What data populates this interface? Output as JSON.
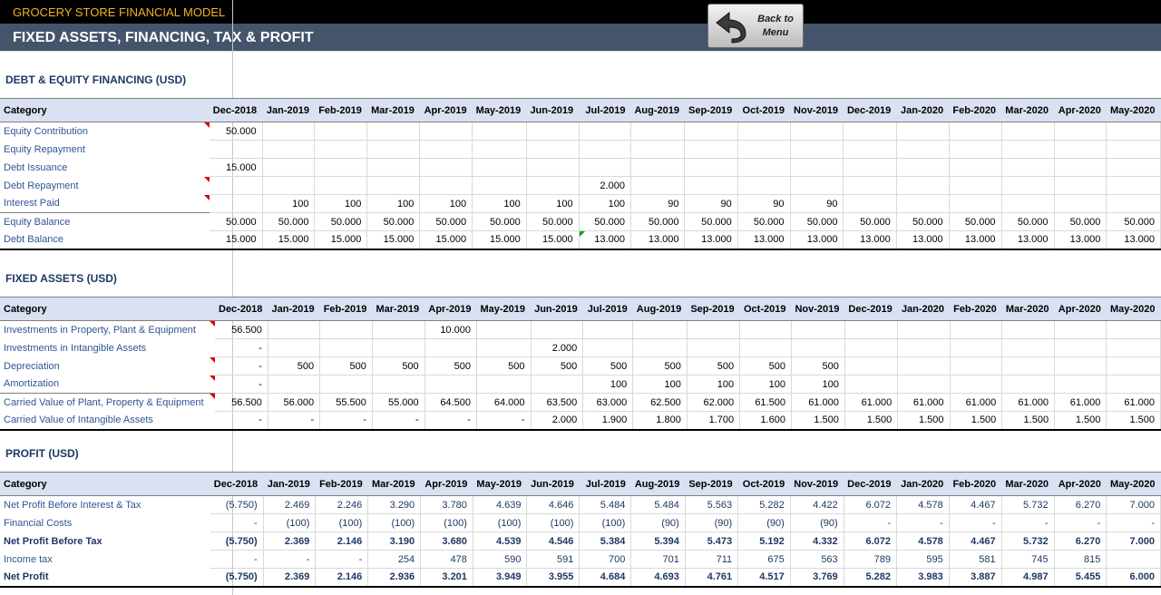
{
  "header": {
    "app_title": "GROCERY STORE FINANCIAL MODEL",
    "page_title": "FIXED ASSETS, FINANCING, TAX & PROFIT",
    "back_button": {
      "line1": "Back to",
      "line2": "Menu"
    }
  },
  "months": [
    "Dec-2018",
    "Jan-2019",
    "Feb-2019",
    "Mar-2019",
    "Apr-2019",
    "May-2019",
    "Jun-2019",
    "Jul-2019",
    "Aug-2019",
    "Sep-2019",
    "Oct-2019",
    "Nov-2019",
    "Dec-2019",
    "Jan-2020",
    "Feb-2020",
    "Mar-2020",
    "Apr-2020",
    "May-2020"
  ],
  "sections": [
    {
      "title": "DEBT & EQUITY FINANCING (USD)",
      "header_label": "Category",
      "rows": [
        {
          "label": "Equity Contribution",
          "values": [
            "50.000",
            "",
            "",
            "",
            "",
            "",
            "",
            "",
            "",
            "",
            "",
            "",
            "",
            "",
            "",
            "",
            "",
            ""
          ]
        },
        {
          "label": "Equity Repayment",
          "values": [
            "",
            "",
            "",
            "",
            "",
            "",
            "",
            "",
            "",
            "",
            "",
            "",
            "",
            "",
            "",
            "",
            "",
            ""
          ]
        },
        {
          "label": "Debt Issuance",
          "values": [
            "15.000",
            "",
            "",
            "",
            "",
            "",
            "",
            "",
            "",
            "",
            "",
            "",
            "",
            "",
            "",
            "",
            "",
            ""
          ]
        },
        {
          "label": "Debt Repayment",
          "values": [
            "",
            "",
            "",
            "",
            "",
            "",
            "",
            "2.000",
            "",
            "",
            "",
            "",
            "",
            "",
            "",
            "",
            "",
            ""
          ]
        },
        {
          "label": "Interest Paid",
          "values": [
            "",
            "100",
            "100",
            "100",
            "100",
            "100",
            "100",
            "100",
            "90",
            "90",
            "90",
            "90",
            "",
            "",
            "",
            "",
            "",
            ""
          ]
        },
        {
          "label": "Equity Balance",
          "values": [
            "50.000",
            "50.000",
            "50.000",
            "50.000",
            "50.000",
            "50.000",
            "50.000",
            "50.000",
            "50.000",
            "50.000",
            "50.000",
            "50.000",
            "50.000",
            "50.000",
            "50.000",
            "50.000",
            "50.000",
            "50.000"
          ]
        },
        {
          "label": "Debt Balance",
          "values": [
            "15.000",
            "15.000",
            "15.000",
            "15.000",
            "15.000",
            "15.000",
            "15.000",
            "13.000",
            "13.000",
            "13.000",
            "13.000",
            "13.000",
            "13.000",
            "13.000",
            "13.000",
            "13.000",
            "13.000",
            "13.000"
          ]
        }
      ]
    },
    {
      "title": "FIXED ASSETS (USD)",
      "header_label": "Category",
      "rows": [
        {
          "label": "Investments in Property, Plant & Equipment",
          "values": [
            "56.500",
            "",
            "",
            "",
            "10.000",
            "",
            "",
            "",
            "",
            "",
            "",
            "",
            "",
            "",
            "",
            "",
            "",
            ""
          ]
        },
        {
          "label": "Investments in Intangible Assets",
          "values": [
            "-",
            "",
            "",
            "",
            "",
            "",
            "2.000",
            "",
            "",
            "",
            "",
            "",
            "",
            "",
            "",
            "",
            "",
            ""
          ]
        },
        {
          "label": "Depreciation",
          "values": [
            "-",
            "500",
            "500",
            "500",
            "500",
            "500",
            "500",
            "500",
            "500",
            "500",
            "500",
            "500",
            "",
            "",
            "",
            "",
            "",
            ""
          ]
        },
        {
          "label": "Amortization",
          "values": [
            "-",
            "",
            "",
            "",
            "",
            "",
            "",
            "100",
            "100",
            "100",
            "100",
            "100",
            "",
            "",
            "",
            "",
            "",
            ""
          ]
        },
        {
          "label": "Carried Value of Plant, Property & Equipment",
          "values": [
            "56.500",
            "56.000",
            "55.500",
            "55.000",
            "64.500",
            "64.000",
            "63.500",
            "63.000",
            "62.500",
            "62.000",
            "61.500",
            "61.000",
            "61.000",
            "61.000",
            "61.000",
            "61.000",
            "61.000",
            "61.000"
          ]
        },
        {
          "label": "Carried Value of Intangible Assets",
          "values": [
            "-",
            "-",
            "-",
            "-",
            "-",
            "-",
            "2.000",
            "1.900",
            "1.800",
            "1.700",
            "1.600",
            "1.500",
            "1.500",
            "1.500",
            "1.500",
            "1.500",
            "1.500",
            "1.500"
          ]
        }
      ]
    },
    {
      "title": "PROFIT (USD)",
      "header_label": "Category",
      "rows": [
        {
          "label": "Net Profit Before Interest & Tax",
          "values": [
            "(5.750)",
            "2.469",
            "2.246",
            "3.290",
            "3.780",
            "4.639",
            "4.646",
            "5.484",
            "5.484",
            "5.563",
            "5.282",
            "4.422",
            "6.072",
            "4.578",
            "4.467",
            "5.732",
            "6.270",
            "7.000"
          ]
        },
        {
          "label": "Financial Costs",
          "values": [
            "-",
            "(100)",
            "(100)",
            "(100)",
            "(100)",
            "(100)",
            "(100)",
            "(100)",
            "(90)",
            "(90)",
            "(90)",
            "(90)",
            "-",
            "-",
            "-",
            "-",
            "-",
            "-"
          ]
        },
        {
          "label": "Net Profit Before Tax",
          "values": [
            "(5.750)",
            "2.369",
            "2.146",
            "3.190",
            "3.680",
            "4.539",
            "4.546",
            "5.384",
            "5.394",
            "5.473",
            "5.192",
            "4.332",
            "6.072",
            "4.578",
            "4.467",
            "5.732",
            "6.270",
            "7.000"
          ]
        },
        {
          "label": "Income tax",
          "values": [
            "-",
            "-",
            "-",
            "254",
            "478",
            "590",
            "591",
            "700",
            "701",
            "711",
            "675",
            "563",
            "789",
            "595",
            "581",
            "745",
            "815",
            ""
          ]
        },
        {
          "label": "Net Profit",
          "values": [
            "(5.750)",
            "2.369",
            "2.146",
            "2.936",
            "3.201",
            "3.949",
            "3.955",
            "4.684",
            "4.693",
            "4.761",
            "4.517",
            "3.769",
            "5.282",
            "3.983",
            "3.887",
            "4.987",
            "5.455",
            "6.000"
          ]
        }
      ]
    }
  ],
  "colors": {
    "header_bg": "#000000",
    "title_bar": "#44546a",
    "accent_orange": "#f0b423",
    "table_header": "#d9e1f2",
    "label_blue": "#2f5597",
    "note_red": "#e00000"
  }
}
